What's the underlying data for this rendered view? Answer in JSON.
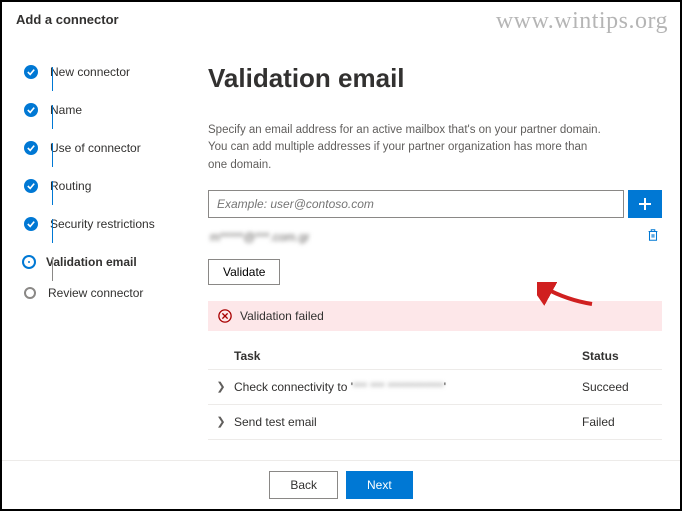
{
  "watermark": "www.wintips.org",
  "header": {
    "title": "Add a connector"
  },
  "sidebar": {
    "steps": [
      {
        "label": "New connector"
      },
      {
        "label": "Name"
      },
      {
        "label": "Use of connector"
      },
      {
        "label": "Routing"
      },
      {
        "label": "Security restrictions"
      },
      {
        "label": "Validation email"
      },
      {
        "label": "Review connector"
      }
    ]
  },
  "main": {
    "title": "Validation email",
    "description": "Specify an email address for an active mailbox that's on your partner domain. You can add multiple addresses if your partner organization has more than one domain.",
    "input_placeholder": "Example: user@contoso.com",
    "added_email": "m*****@***.com.gr",
    "validate_label": "Validate",
    "error_text": "Validation failed",
    "table": {
      "col_task": "Task",
      "col_status": "Status",
      "rows": [
        {
          "task_prefix": "Check connectivity to '",
          "task_blur": "*** *** ************",
          "task_suffix": "'",
          "status": "Succeed"
        },
        {
          "task_prefix": "Send test email",
          "task_blur": "",
          "task_suffix": "",
          "status": "Failed"
        }
      ]
    }
  },
  "footer": {
    "back": "Back",
    "next": "Next"
  }
}
